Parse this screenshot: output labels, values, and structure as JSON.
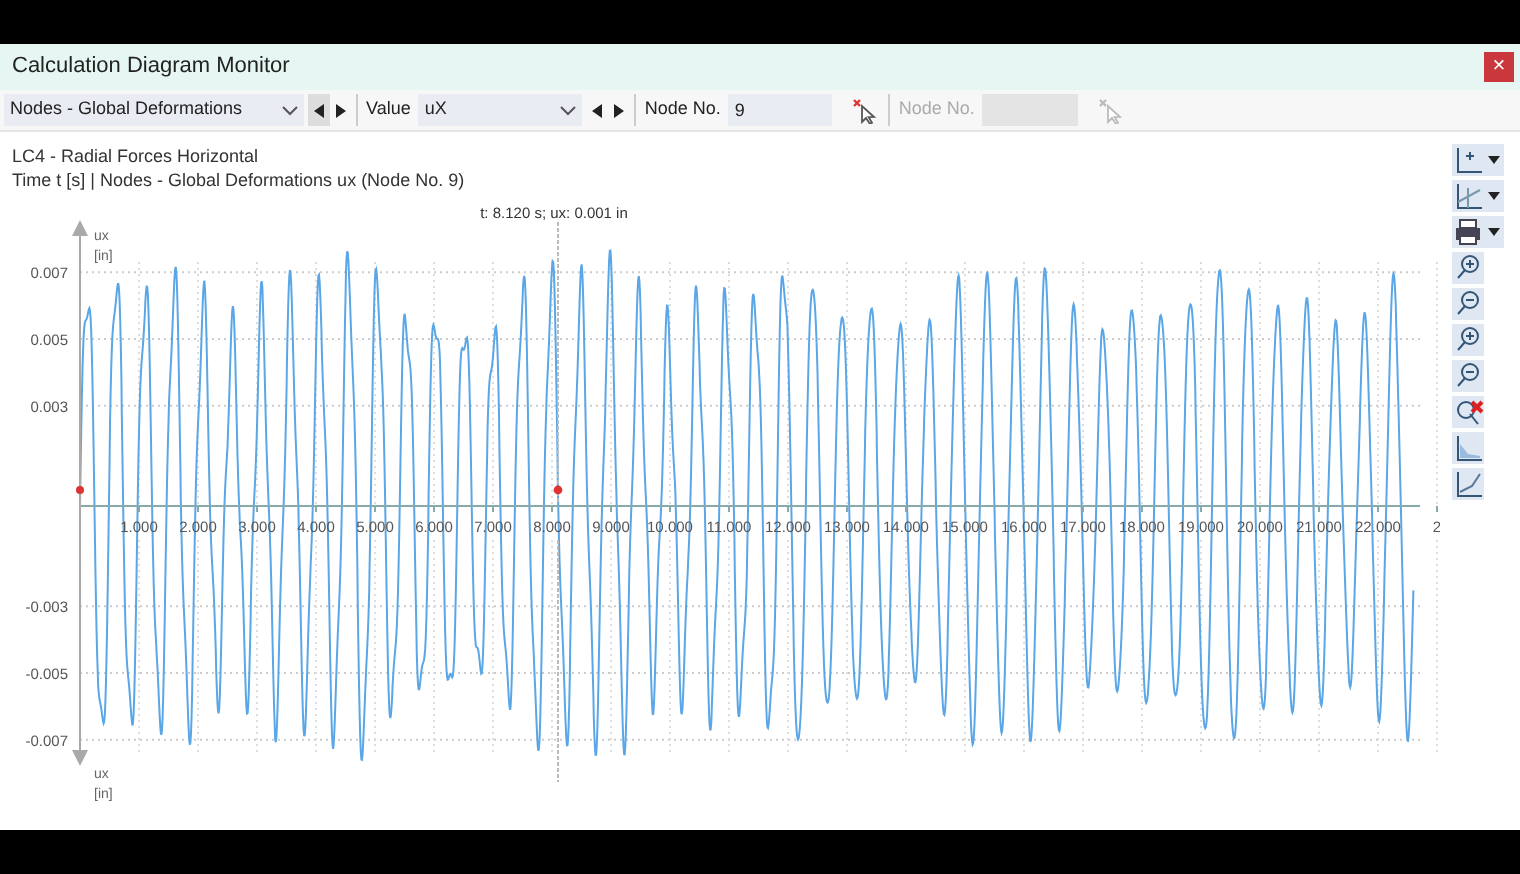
{
  "window": {
    "title": "Calculation Diagram Monitor",
    "close": "×"
  },
  "toolbar": {
    "category": {
      "value": "Nodes - Global Deformations"
    },
    "value_label": "Value",
    "value": {
      "value": "uX"
    },
    "node_label": "Node No.",
    "node_value": "9",
    "node_label_2": "Node No.",
    "node_2_disabled": true
  },
  "headings": [
    "LC4 - Radial Forces Horizontal",
    "Time t [s] | Nodes - Global Deformations ux (Node No. 9)"
  ],
  "chart": {
    "cursor_readout": "t: 8.120 s; ux: 0.001 in",
    "y_label_top": [
      "ux",
      "[in]"
    ],
    "y_label_bottom": [
      "ux",
      "[in]"
    ],
    "yticks": [
      "0.007",
      "0.005",
      "0.003",
      "-0.003",
      "-0.005",
      "-0.007"
    ],
    "xticks": [
      "1.000",
      "2.000",
      "3.000",
      "4.000",
      "5.000",
      "6.000",
      "7.000",
      "8.000",
      "9.000",
      "10.000",
      "11.000",
      "12.000",
      "13.000",
      "14.000",
      "15.000",
      "16.000",
      "17.000",
      "18.000",
      "19.000",
      "20.000",
      "21.000",
      "22.000",
      "2"
    ]
  }
}
